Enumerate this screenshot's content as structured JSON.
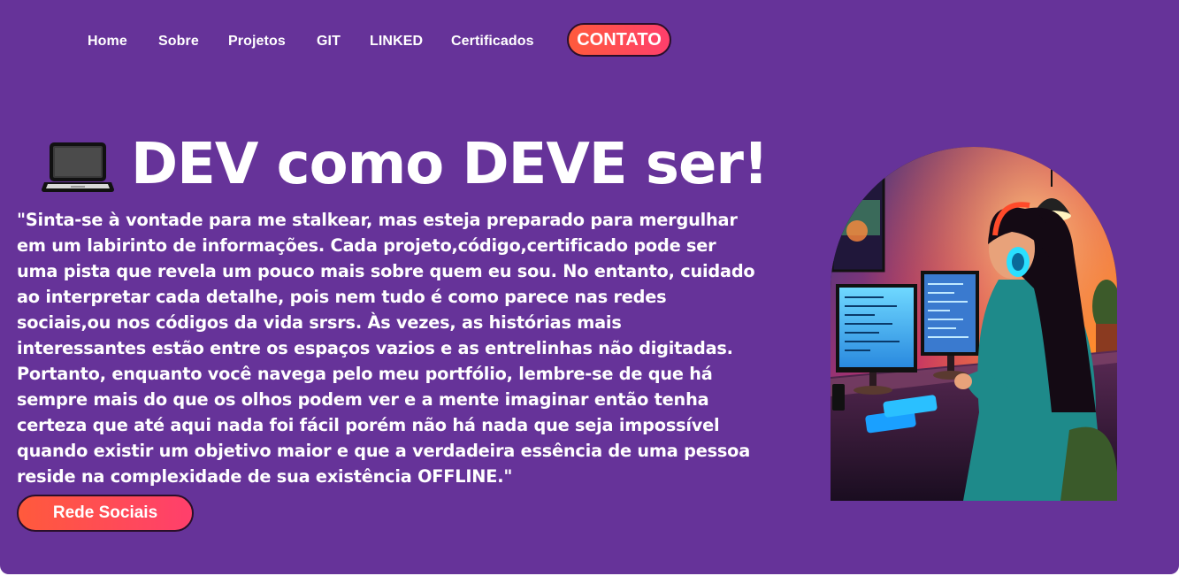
{
  "nav": {
    "items": [
      {
        "label": "Home"
      },
      {
        "label": "Sobre"
      },
      {
        "label": "Projetos"
      },
      {
        "label": "GIT"
      },
      {
        "label": "LINKED"
      },
      {
        "label": "Certificados"
      }
    ],
    "contact_label": "CONTATO"
  },
  "hero": {
    "icon": "laptop-icon",
    "title": "DEV como DEVE ser!",
    "quote_lines": [
      "\"Sinta-se à vontade para me stalkear, mas esteja preparado para mergulhar",
      "em um labirinto de informações. Cada projeto,código,certificado pode ser",
      "uma pista que revela um pouco mais sobre quem eu sou. No entanto, cuidado",
      "ao interpretar cada detalhe, pois nem tudo é como parece nas redes",
      "sociais,ou nos códigos da vida srsrs. Às vezes, as histórias mais",
      "interessantes estão entre os espaços vazios e as entrelinhas não digitadas.",
      "Portanto, enquanto você navega pelo meu portfólio, lembre-se de que há",
      "sempre mais do que os olhos podem ver e a mente imaginar então tenha",
      "certeza que até aqui nada foi fácil porém não há nada que seja impossível",
      "quando existir um objetivo maior e que a verdadeira essência de uma pessoa",
      "reside na complexidade de sua existência OFFLINE.\""
    ],
    "social_button_label": "Rede Sociais"
  },
  "colors": {
    "background": "#663399",
    "accent_start": "#ff5a3c",
    "accent_end": "#ff3f6c",
    "text": "#ffffff"
  }
}
